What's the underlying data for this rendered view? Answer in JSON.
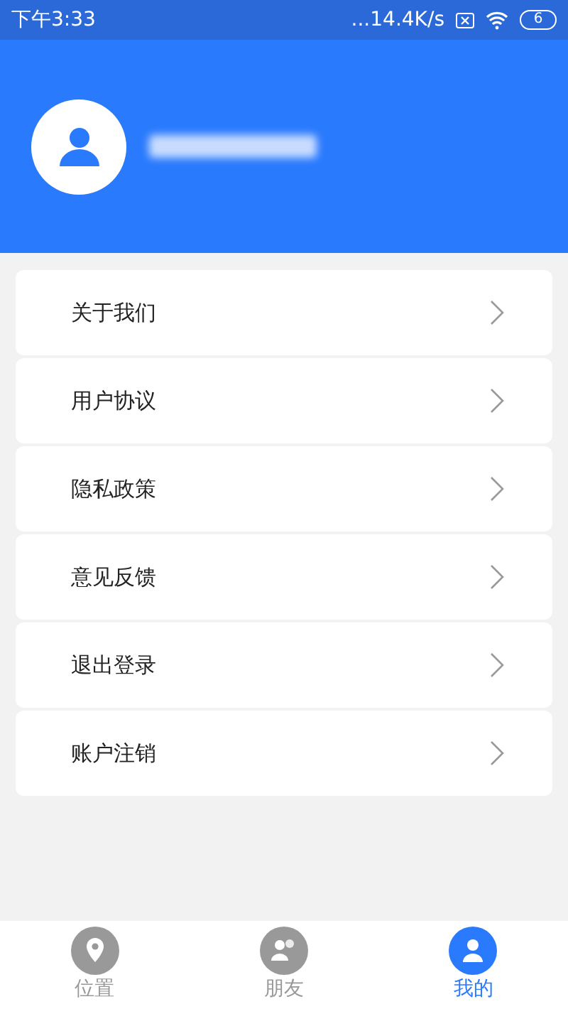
{
  "status_bar": {
    "time": "下午3:33",
    "speed": "...14.4K/s",
    "battery": "6"
  },
  "menu": [
    {
      "label": "关于我们"
    },
    {
      "label": "用户协议"
    },
    {
      "label": "隐私政策"
    },
    {
      "label": "意见反馈"
    },
    {
      "label": "退出登录"
    },
    {
      "label": "账户注销"
    }
  ],
  "tabs": [
    {
      "label": "位置",
      "selected": false,
      "kind": "location"
    },
    {
      "label": "朋友",
      "selected": false,
      "kind": "friends"
    },
    {
      "label": "我的",
      "selected": true,
      "kind": "profile"
    }
  ]
}
